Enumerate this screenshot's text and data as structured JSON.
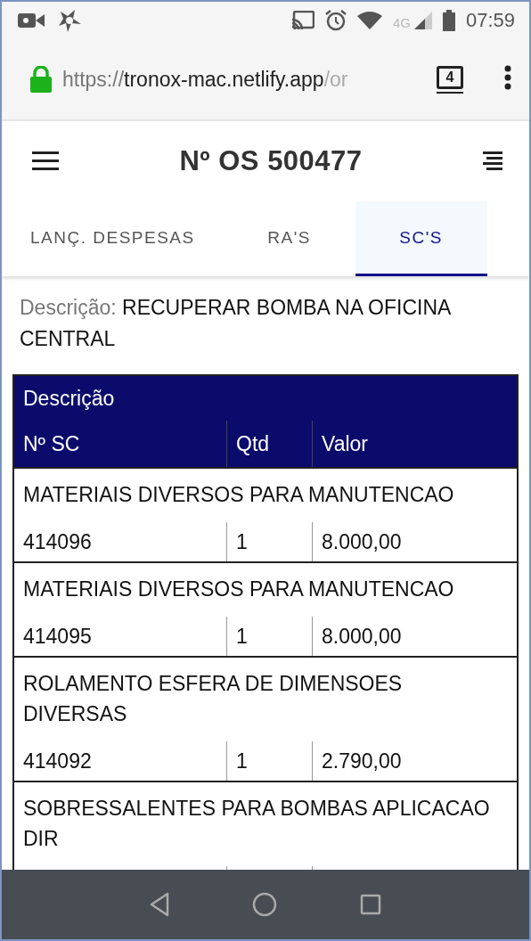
{
  "status_bar": {
    "network": "4G",
    "time": "07:59"
  },
  "browser": {
    "url_scheme": "https://",
    "url_host": "tronox-mac.netlify.app",
    "url_path": "/or",
    "tab_count": "4"
  },
  "header": {
    "title": "Nº OS 500477"
  },
  "tabs": [
    {
      "label": "LANÇ. DESPESAS",
      "selected": false
    },
    {
      "label": "RA'S",
      "selected": false
    },
    {
      "label": "SC'S",
      "selected": true
    }
  ],
  "description": {
    "label": "Descrição:",
    "value": "RECUPERAR BOMBA NA OFICINA CENTRAL"
  },
  "table": {
    "title": "Descrição",
    "columns": [
      "Nº SC",
      "Qtd",
      "Valor"
    ],
    "rows": [
      {
        "description": "MATERIAIS DIVERSOS PARA MANUTENCAO",
        "cells": [
          "414096",
          "1",
          "8.000,00"
        ]
      },
      {
        "description": "MATERIAIS DIVERSOS PARA MANUTENCAO",
        "cells": [
          "414095",
          "1",
          "8.000,00"
        ]
      },
      {
        "description": "ROLAMENTO ESFERA DE DIMENSOES DIVERSAS",
        "cells": [
          "414092",
          "1",
          "2.790,00"
        ]
      },
      {
        "description": "SOBRESSALENTES PARA BOMBAS APLICACAO DIR"
      }
    ]
  }
}
